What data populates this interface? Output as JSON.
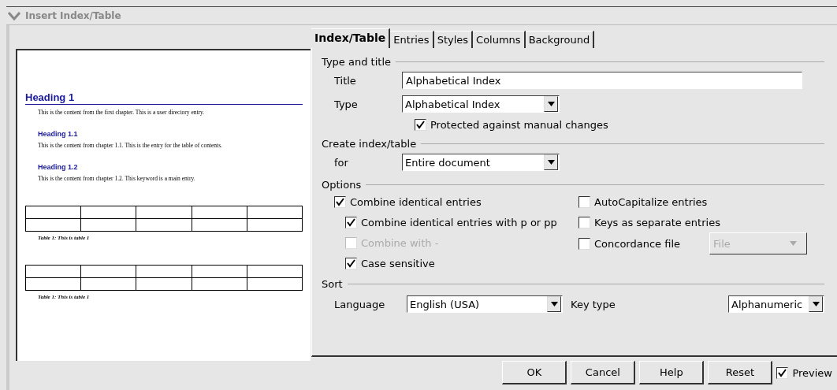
{
  "window": {
    "title": "Insert Index/Table"
  },
  "preview": {
    "blocks": [
      {
        "kind": "h1",
        "text": "Heading 1"
      },
      {
        "kind": "p",
        "text": "This is the content from the first chapter. This is a user directory entry."
      },
      {
        "kind": "h2",
        "text": "Heading 1.1"
      },
      {
        "kind": "p",
        "text": "This is the content from chapter 1.1. This is the entry for the table of contents."
      },
      {
        "kind": "h2",
        "text": "Heading 1.2"
      },
      {
        "kind": "p",
        "text": "This is the content from chapter 1.2. This keyword is a main entry."
      },
      {
        "kind": "table",
        "text": "Table 1: This is table 1"
      },
      {
        "kind": "table",
        "text": "Table 1: This is table 1"
      }
    ]
  },
  "tabs": [
    {
      "label": "Index/Table",
      "selected": true
    },
    {
      "label": "Entries",
      "selected": false
    },
    {
      "label": "Styles",
      "selected": false
    },
    {
      "label": "Columns",
      "selected": false
    },
    {
      "label": "Background",
      "selected": false
    }
  ],
  "type_and_title": {
    "heading": "Type and title",
    "title_label": "Title",
    "title_value": "Alphabetical Index",
    "type_label": "Type",
    "type_value": "Alphabetical Index",
    "protected": {
      "label": "Protected against manual changes",
      "checked": true
    }
  },
  "create": {
    "heading": "Create index/table",
    "for_label": "for",
    "for_value": "Entire document"
  },
  "options": {
    "heading": "Options",
    "left": [
      {
        "label": "Combine identical entries",
        "checked": true,
        "disabled": false,
        "children": [
          {
            "label": "Combine identical entries with p or pp",
            "checked": true,
            "disabled": false
          },
          {
            "label": "Combine with -",
            "checked": false,
            "disabled": true
          },
          {
            "label": "Case sensitive",
            "checked": true,
            "disabled": false
          }
        ]
      }
    ],
    "right": [
      {
        "label": "AutoCapitalize entries",
        "checked": false,
        "disabled": false
      },
      {
        "label": "Keys as separate entries",
        "checked": false,
        "disabled": false
      },
      {
        "label": "Concordance file",
        "checked": false,
        "disabled": false,
        "file_button": {
          "label": "File",
          "disabled": true
        }
      }
    ]
  },
  "sort": {
    "heading": "Sort",
    "language_label": "Language",
    "language_value": "English (USA)",
    "key_label": "Key type",
    "key_value": "Alphanumeric"
  },
  "buttons": [
    "OK",
    "Cancel",
    "Help",
    "Reset"
  ],
  "preview_toggle": {
    "label": "Preview",
    "checked": true
  }
}
